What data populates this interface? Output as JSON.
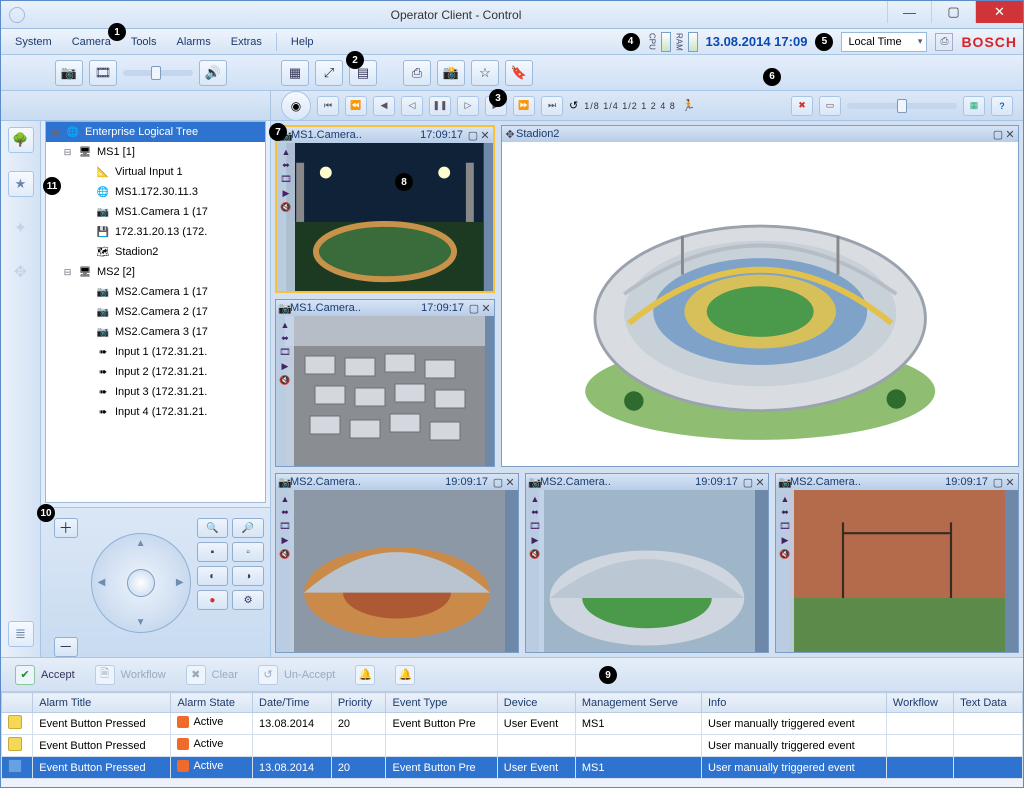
{
  "window": {
    "title": "Operator Client - Control"
  },
  "menu": {
    "items": [
      "System",
      "Camera",
      "Tools",
      "Alarms",
      "Extras"
    ],
    "help": "Help",
    "datetime": "13.08.2014 17:09",
    "timezone": "Local Time",
    "brand": "BOSCH",
    "cpu_label": "CPU",
    "ram_label": "RAM"
  },
  "playback": {
    "speed_scale": "1/8 1/4 1/2  1   2   4   8"
  },
  "tree": {
    "root": "Enterprise Logical Tree",
    "nodes": [
      {
        "label": "MS1 [1]",
        "expand": "⊟",
        "indent": 1,
        "icon": "server"
      },
      {
        "label": "Virtual Input 1",
        "indent": 2,
        "icon": "vinput"
      },
      {
        "label": "MS1.172.30.11.3",
        "indent": 2,
        "icon": "globe"
      },
      {
        "label": "MS1.Camera 1 (17",
        "indent": 2,
        "icon": "cam"
      },
      {
        "label": "172.31.20.13 (172.",
        "indent": 2,
        "icon": "iscsi"
      },
      {
        "label": "Stadion2",
        "indent": 2,
        "icon": "map"
      },
      {
        "label": "MS2 [2]",
        "expand": "⊟",
        "indent": 1,
        "icon": "server"
      },
      {
        "label": "MS2.Camera 1 (17",
        "indent": 2,
        "icon": "cam"
      },
      {
        "label": "MS2.Camera 2 (17",
        "indent": 2,
        "icon": "cam"
      },
      {
        "label": "MS2.Camera 3 (17",
        "indent": 2,
        "icon": "cam"
      },
      {
        "label": "Input 1 (172.31.21.",
        "indent": 2,
        "icon": "input"
      },
      {
        "label": "Input 2 (172.31.21.",
        "indent": 2,
        "icon": "input"
      },
      {
        "label": "Input 3 (172.31.21.",
        "indent": 2,
        "icon": "input"
      },
      {
        "label": "Input 4 (172.31.21.",
        "indent": 2,
        "icon": "input"
      }
    ]
  },
  "panes": {
    "p1": {
      "title": "MS1.Camera..",
      "time": "17:09:17"
    },
    "p2": {
      "title": "MS1.Camera..",
      "time": "17:09:17"
    },
    "big": {
      "title": "Stadion2"
    },
    "b1": {
      "title": "MS2.Camera..",
      "time": "19:09:17"
    },
    "b2": {
      "title": "MS2.Camera..",
      "time": "19:09:17"
    },
    "b3": {
      "title": "MS2.Camera..",
      "time": "19:09:17"
    }
  },
  "alarm_toolbar": {
    "accept": "Accept",
    "workflow": "Workflow",
    "clear": "Clear",
    "unaccept": "Un-Accept"
  },
  "alarm_table": {
    "cols": [
      "",
      "Alarm Title",
      "Alarm State",
      "Date/Time",
      "Priority",
      "Event Type",
      "Device",
      "Management Serve",
      "Info",
      "Workflow",
      "Text Data"
    ],
    "rows": [
      {
        "sel": false,
        "icon": "warn",
        "title": "Event Button Pressed",
        "state": "Active",
        "date": "13.08.2014",
        "prio": "20",
        "etype": "Event Button Pre",
        "device": "User Event",
        "ms": "MS1",
        "info": "User manually triggered event",
        "wf": "",
        "td": ""
      },
      {
        "sel": false,
        "icon": "warn",
        "title": "Event Button Pressed",
        "state": "Active",
        "date": "",
        "prio": "",
        "etype": "",
        "device": "",
        "ms": "",
        "info": "User manually triggered event",
        "wf": "",
        "td": ""
      },
      {
        "sel": true,
        "icon": "blue",
        "title": "Event Button Pressed",
        "state": "Active",
        "date": "13.08.2014",
        "prio": "20",
        "etype": "Event Button Pre",
        "device": "User Event",
        "ms": "MS1",
        "info": "User manually triggered event",
        "wf": "",
        "td": ""
      }
    ]
  },
  "callouts": {
    "c1": "1",
    "c2": "2",
    "c3": "3",
    "c4": "4",
    "c5": "5",
    "c6": "6",
    "c7": "7",
    "c8": "8",
    "c9": "9",
    "c10": "10",
    "c11": "11"
  }
}
